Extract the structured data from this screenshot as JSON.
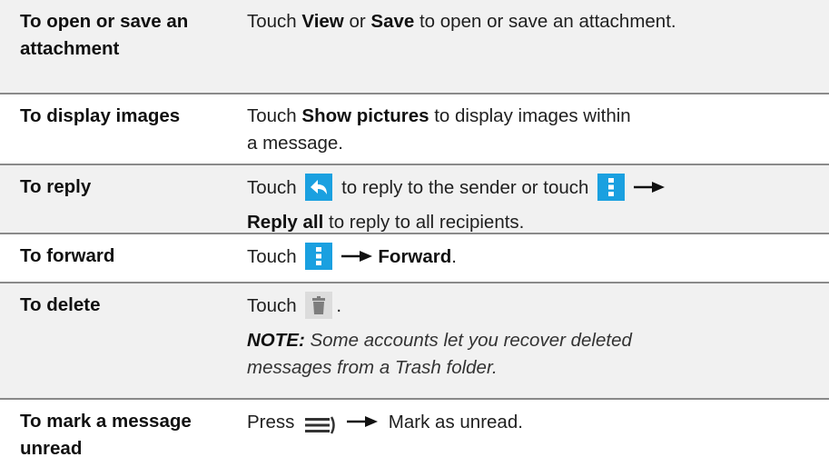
{
  "rows": [
    {
      "action": "To open or save an attachment",
      "desc": {
        "pre": "Touch ",
        "b1": "View",
        "mid": " or ",
        "b2": "Save",
        "post": " to open or save an attachment."
      }
    },
    {
      "action": "To display images",
      "desc": {
        "pre": "Touch ",
        "b1": "Show pictures",
        "post": " to display images within",
        "post2": "a message."
      }
    },
    {
      "action": "To reply",
      "desc": {
        "pre": "Touch ",
        "mid": " to reply to the sender or touch ",
        "b1": "Reply all",
        "post": " to reply to all recipients."
      }
    },
    {
      "action": "To forward",
      "desc": {
        "pre": "Touch ",
        "b1": "Forward",
        "post": "."
      }
    },
    {
      "action": "To delete",
      "desc": {
        "pre": "Touch ",
        "post": ".",
        "note_label": "NOTE:",
        "note_text": " Some accounts let you recover deleted",
        "note_text2": "messages from a Trash folder."
      }
    },
    {
      "action": "To mark a message unread",
      "desc": {
        "pre": "Press ",
        "post": " Mark as unread."
      }
    }
  ],
  "icons": {
    "reply": "reply-icon",
    "overflow": "overflow-menu-icon",
    "delete": "trash-icon",
    "menu": "menu-key-icon",
    "arrow": "right-arrow-icon"
  },
  "colors": {
    "shaded_row": "#f1f1f1",
    "icon_blue": "#1aa0e0",
    "divider": "#8a8a8a"
  }
}
